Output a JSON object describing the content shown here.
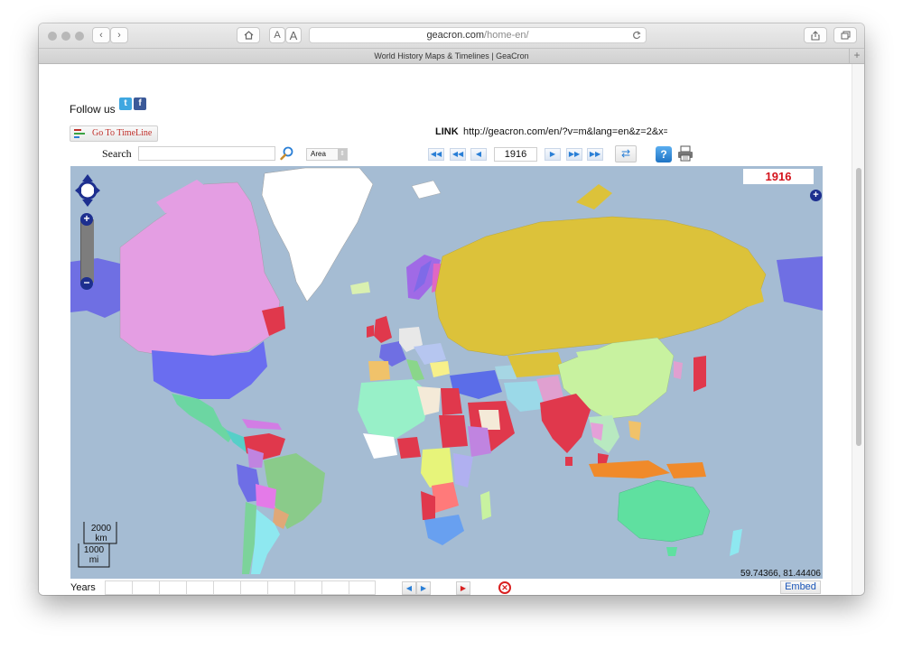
{
  "browser": {
    "url_host": "geacron.com",
    "url_path": "/home-en/",
    "tab_title": "World History Maps & Timelines | GeaCron",
    "font_size_small": "A",
    "font_size_large": "A",
    "new_tab": "+"
  },
  "header": {
    "follow_label": "Follow us",
    "twitter_glyph": "t",
    "facebook_glyph": "f",
    "goto_timeline_label": "Go To TimeLine",
    "link_label": "LINK",
    "link_url": "http://geacron.com/en/?v=m&lang=en&z=2&x=2"
  },
  "toolbar": {
    "search_label": "Search",
    "search_value": "",
    "select_value": "Area",
    "year_value": "1916",
    "help_glyph": "?"
  },
  "map": {
    "year_display": "1916",
    "coordinates": "59.74366, 81.44406",
    "scale_km_value": "2000",
    "scale_km_unit": "km",
    "scale_mi_value": "1000",
    "scale_mi_unit": "mi",
    "zoom_in_glyph": "+",
    "zoom_out_glyph": "−",
    "expand_glyph": "+"
  },
  "footer": {
    "years_label": "Years",
    "embed_label": "Embed"
  },
  "icons": {
    "twitter": "twitter-icon",
    "facebook": "facebook-icon",
    "search": "search-icon",
    "print": "print-icon",
    "sync": "sync-icon",
    "help": "help-icon"
  },
  "colors": {
    "ocean": "#a5bcd3",
    "year_red": "#d4141c",
    "control_navy": "#1d2f8f",
    "nav_blue": "#2a7fd6"
  }
}
